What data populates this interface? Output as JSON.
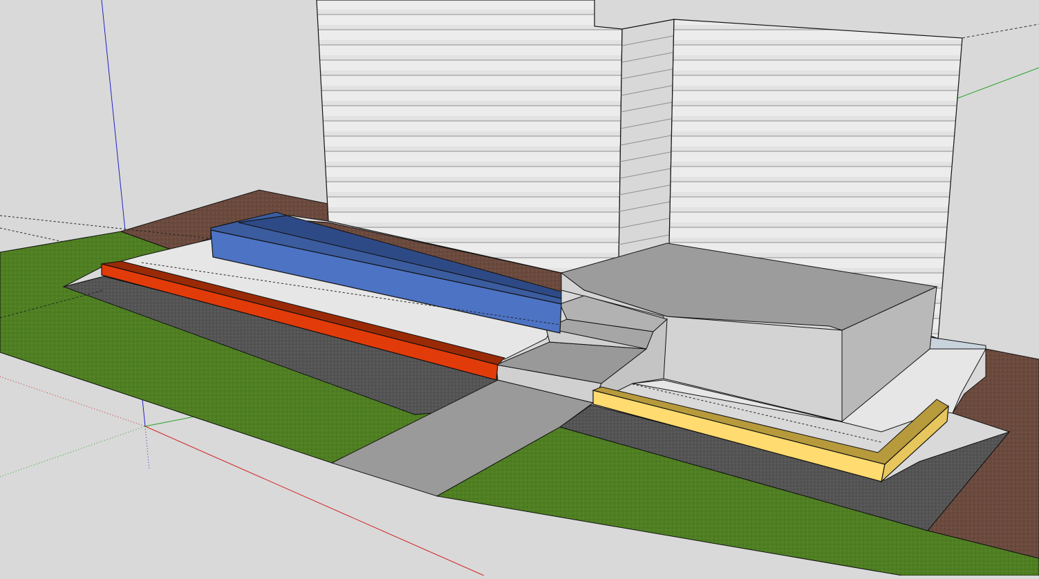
{
  "viewport": {
    "background": "#d9d9d9",
    "view": "perspective"
  },
  "axes": {
    "red": "#d42020",
    "green": "#22a022",
    "blue": "#2020c8"
  },
  "materials": {
    "siding": "#ececec",
    "siding_lines": "#8e8e8e",
    "siding_shadow": "#d2d2d2",
    "grass": "#4f7f22",
    "mulch": "#6b4a3e",
    "gravel": "#545454",
    "concrete_light": "#dcdcdc",
    "concrete_mid": "#bfbfbf",
    "concrete_dark": "#8f8f8f",
    "slab": "#e6e6e6",
    "blue_planter": "#4d73c4",
    "blue_planter_dark": "#2e4a86",
    "red_curb": "#e23b0a",
    "red_curb_dark": "#9a2a05",
    "yellow_curb": "#ffdb70",
    "yellow_curb_dark": "#b79a3c",
    "edge": "#111111"
  }
}
